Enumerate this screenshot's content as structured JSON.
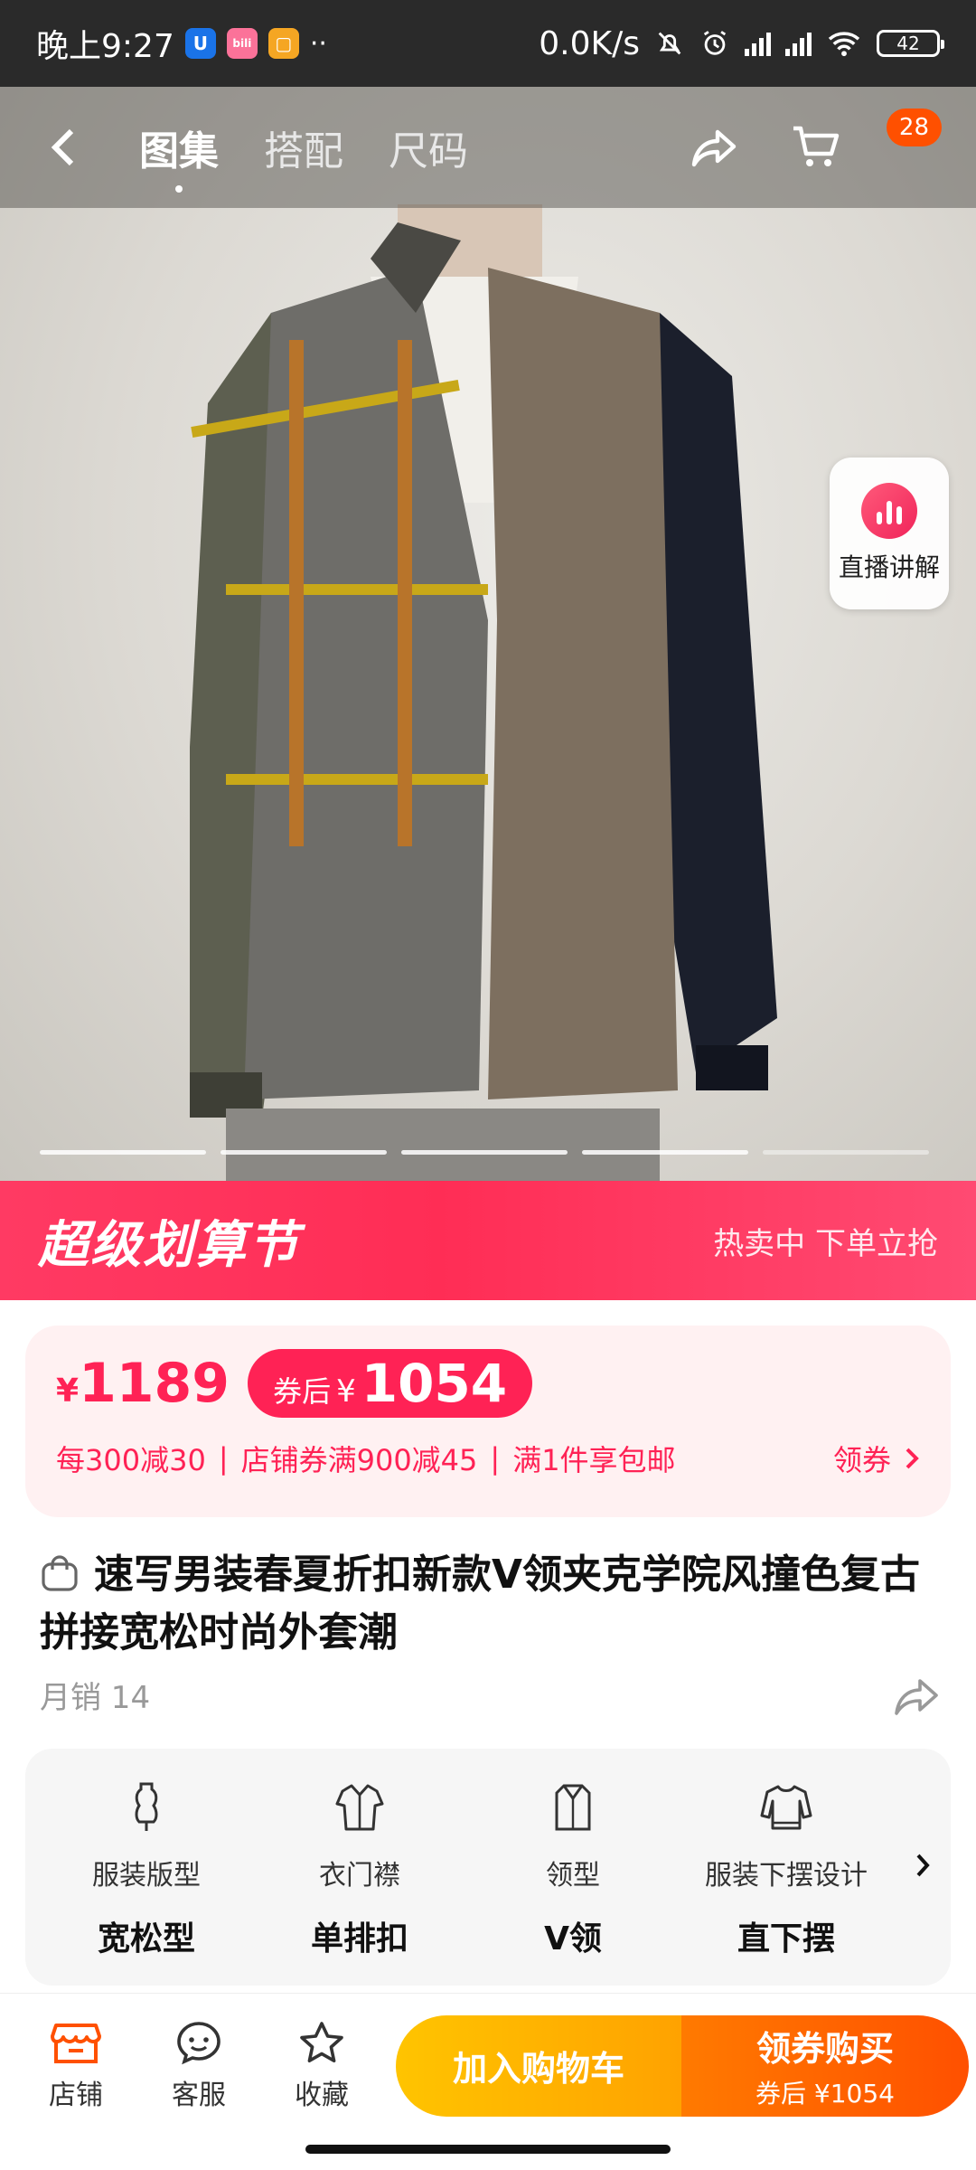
{
  "status_bar": {
    "time": "晚上9:27",
    "net_speed": "0.0K/s",
    "battery": "42",
    "app_icons": [
      "U",
      "bilibili",
      "note",
      "more-dots"
    ]
  },
  "nav": {
    "tabs": [
      {
        "label": "图集",
        "active": true
      },
      {
        "label": "搭配",
        "active": false
      },
      {
        "label": "尺码",
        "active": false
      }
    ],
    "cart_count": "28"
  },
  "side_float": {
    "label": "直播讲解"
  },
  "gallery": {
    "pages": 5,
    "current": 1
  },
  "promo_banner": {
    "title": "超级划算节",
    "subtitle": "热卖中 下单立抢"
  },
  "price": {
    "yen": "¥",
    "current": "1189",
    "coupon_label": "券后",
    "coupon_value": "1054",
    "offers": [
      "每300减30",
      "店铺券满900减45",
      "满1件享包邮"
    ],
    "claim_label": "领券"
  },
  "product": {
    "title": "速写男装春夏折扣新款V领夹克学院风撞色复古拼接宽松时尚外套潮",
    "sales": "月销 14"
  },
  "attributes": [
    {
      "icon": "dress-form-icon",
      "name": "服装版型",
      "value": "宽松型"
    },
    {
      "icon": "shirt-placket-icon",
      "name": "衣门襟",
      "value": "单排扣"
    },
    {
      "icon": "collar-icon",
      "name": "领型",
      "value": "V领"
    },
    {
      "icon": "sweater-hem-icon",
      "name": "服装下摆设计",
      "value": "直下摆"
    }
  ],
  "bottom_bar": {
    "shop": "店铺",
    "service": "客服",
    "favorite": "收藏",
    "add_cart": "加入购物车",
    "buy": "领券购买",
    "buy_sub": "券后 ¥1054"
  },
  "colors": {
    "accent_red": "#ff2255",
    "orange": "#ff5000",
    "yellow": "#ffc400",
    "statusbar": "#2a2a2a"
  }
}
